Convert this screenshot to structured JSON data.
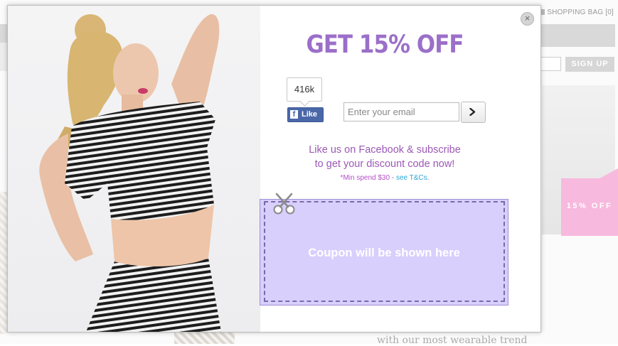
{
  "background": {
    "shopping_bag_label": "SHOPPING BAG [0]",
    "signup_label": "SIGN UP",
    "promo_tab_label": "15% OFF",
    "bottom_text": "with our most wearable trend"
  },
  "modal": {
    "headline": "GET 15% OFF",
    "close_label": "×",
    "facebook": {
      "like_count": "416k",
      "like_label": "Like",
      "f_glyph": "f"
    },
    "email": {
      "placeholder": "Enter your email",
      "value": ""
    },
    "submit_icon": "chevron-right-icon",
    "subscribe_text_line1": "Like us on Facebook & subscribe",
    "subscribe_text_line2": "to get your discount code now!",
    "min_spend_text": "*Min spend $30 - ",
    "tc_link": "see T&Cs",
    "tc_suffix": ".",
    "coupon_placeholder": "Coupon will be shown here"
  },
  "colors": {
    "headline": "#9b6fc9",
    "coupon_bg": "#d8cffd",
    "promo_tab": "#f7b9de",
    "facebook": "#4a67a8"
  }
}
